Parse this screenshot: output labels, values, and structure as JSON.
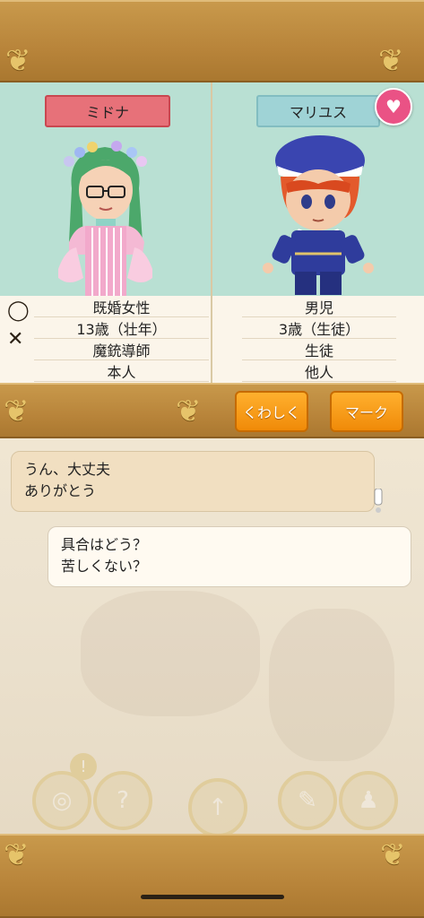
{
  "characters": {
    "left": {
      "name": "ミドナ",
      "info": [
        "既婚女性",
        "13歳（壮年）",
        "魔銃導師",
        "本人"
      ]
    },
    "right": {
      "name": "マリユス",
      "info": [
        "男児",
        "3歳（生徒）",
        "生徒",
        "他人"
      ]
    }
  },
  "side_icons": [
    "ring-icon",
    "crossed-swords-icon"
  ],
  "buttons": {
    "details_label": "くわしく",
    "mark_label": "マーク"
  },
  "messages": [
    {
      "speaker": "left",
      "lines": [
        "うん、大丈夫",
        "ありがとう"
      ]
    },
    {
      "speaker": "right",
      "lines": [
        "具合はどう？",
        "苦しくない？"
      ]
    }
  ],
  "colors": {
    "frame": "#b8843a",
    "panel_bg": "#b9e0d3",
    "left_tag": "#e77179",
    "right_tag": "#9fd3d6",
    "button": "#f59a12",
    "heart": "#ea5285"
  }
}
